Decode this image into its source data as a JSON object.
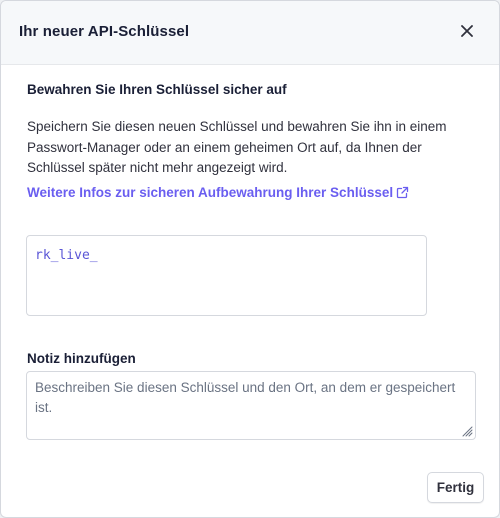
{
  "dialog": {
    "title": "Ihr neuer API-Schlüssel",
    "close_icon": "close-icon"
  },
  "content": {
    "heading": "Bewahren Sie Ihren Schlüssel sicher auf",
    "description": "Speichern Sie diesen neuen Schlüssel und bewahren Sie ihn in einem Passwort-Manager oder an einem geheimen Ort auf, da Ihnen der Schlüssel später nicht mehr angezeigt wird.",
    "link_text": "Weitere Infos zur sicheren Aufbewahrung Ihrer Schlüssel",
    "link_icon": "external-link-icon",
    "key_value": "rk_live_"
  },
  "note": {
    "label": "Notiz hinzufügen",
    "placeholder": "Beschreiben Sie diesen Schlüssel und den Ort, an dem er gespeichert ist.",
    "value": ""
  },
  "footer": {
    "done_label": "Fertig"
  },
  "colors": {
    "accent": "#6a5ef0",
    "key_text": "#5a56d6",
    "heading": "#1a1f36",
    "body_text": "#30313d",
    "border": "#d5d8de",
    "header_bg": "#f6f8fa"
  }
}
